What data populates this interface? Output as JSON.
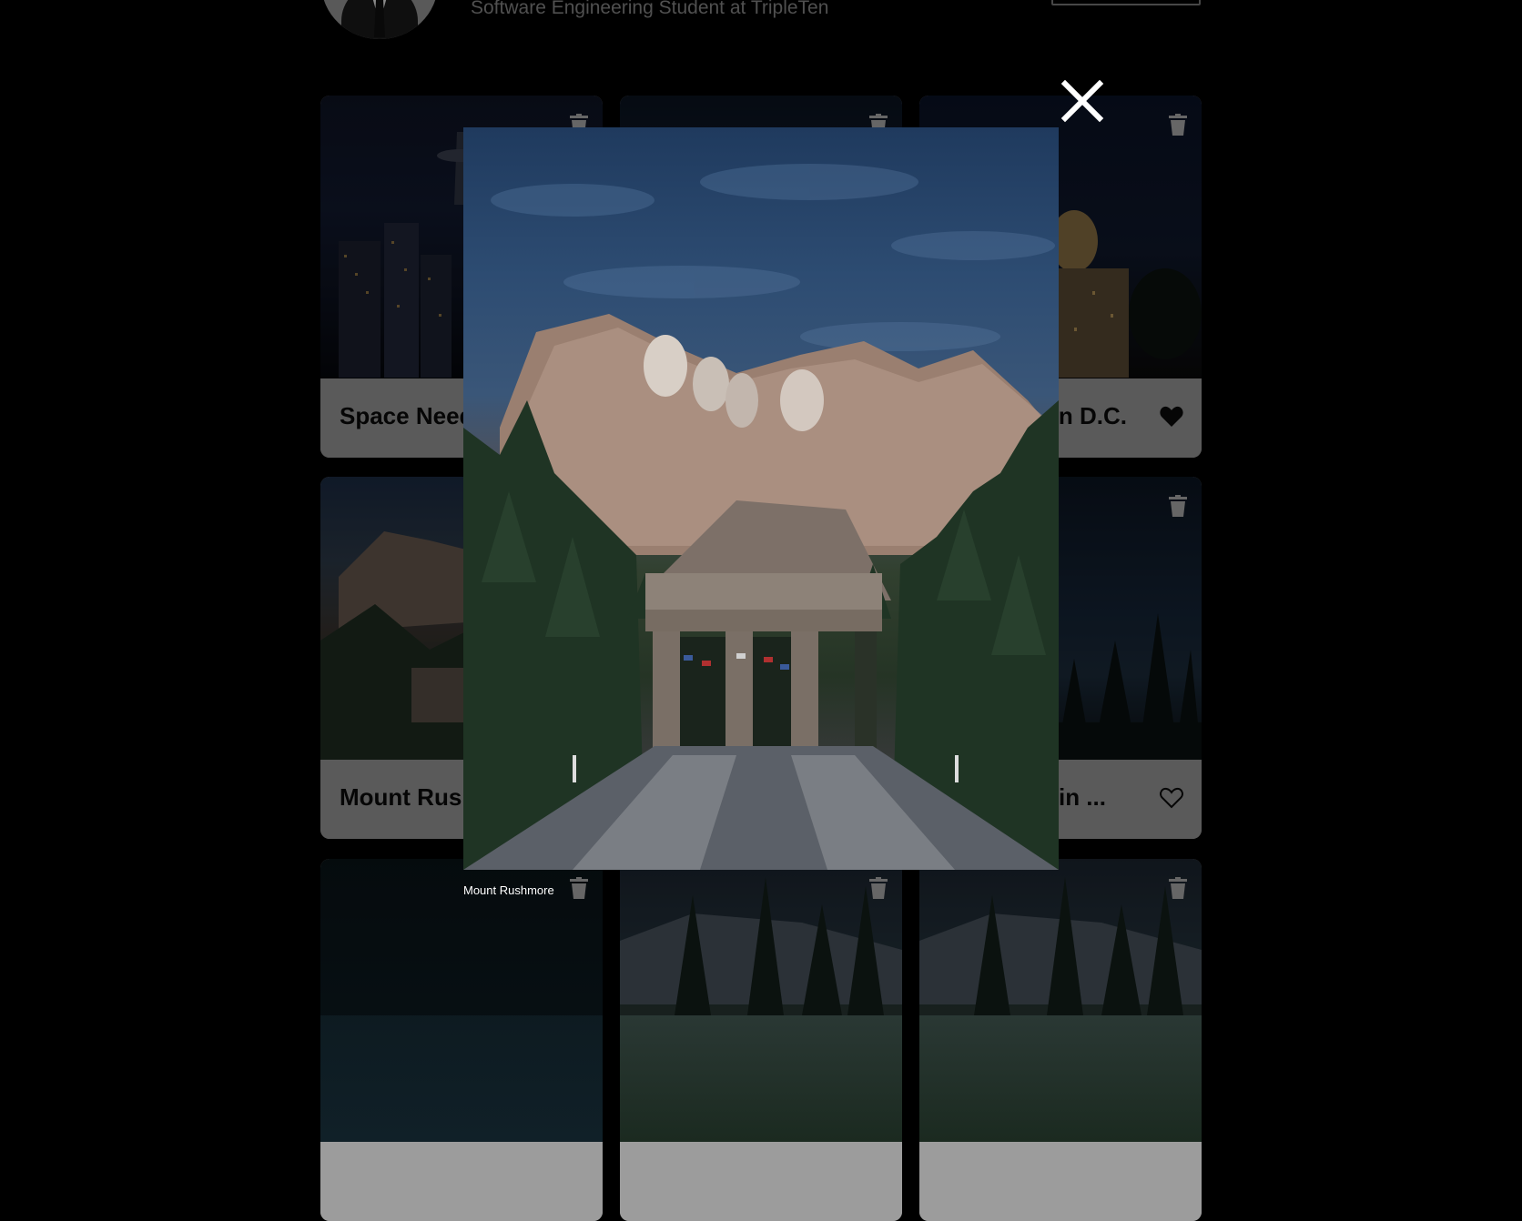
{
  "profile": {
    "subtitle": "Software Engineering Student at TripleTen"
  },
  "cards": [
    {
      "title": "Space Needle",
      "liked": false
    },
    {
      "title": "",
      "liked": false
    },
    {
      "title": "Washington D.C.",
      "liked": true
    },
    {
      "title": "Mount Rushmore",
      "liked": false
    },
    {
      "title": "",
      "liked": false
    },
    {
      "title": "Milky Way in ...",
      "liked": false
    },
    {
      "title": "",
      "liked": false
    },
    {
      "title": "",
      "liked": false
    },
    {
      "title": "",
      "liked": false
    }
  ],
  "modal": {
    "caption": "Mount Rushmore"
  },
  "icons": {
    "close": "close-icon",
    "trash": "trash-icon",
    "heart_filled": "heart-filled-icon",
    "heart_outline": "heart-outline-icon"
  },
  "colors": {
    "background": "#000000",
    "card_footer": "#9c9c9c",
    "text_dark": "#0b0b0b",
    "caption": "#ffffff"
  }
}
